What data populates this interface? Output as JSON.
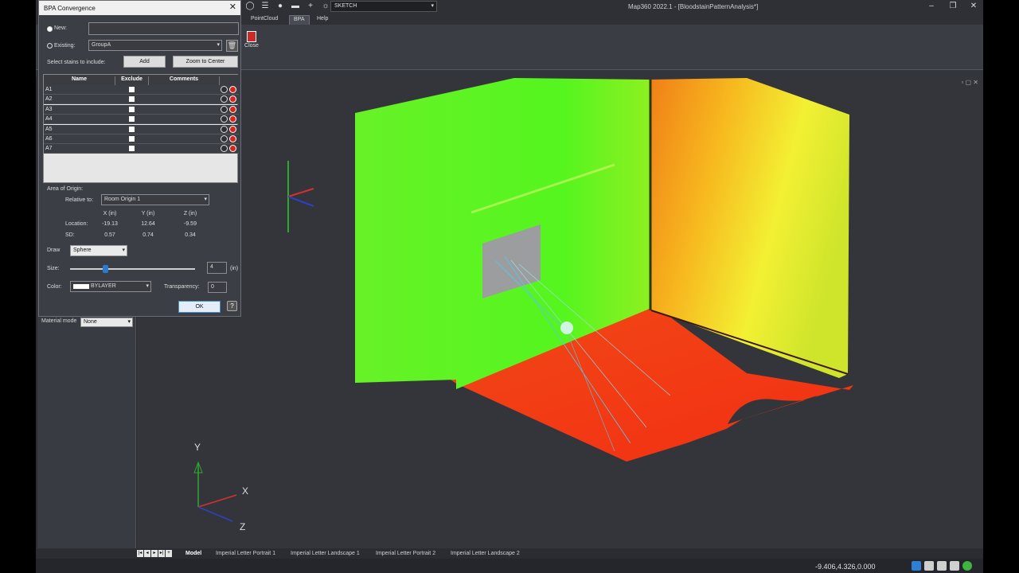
{
  "window": {
    "title": "Map360 2022.1 - [BloodstainPatternAnalysis*]",
    "workspace": "SKETCH"
  },
  "ribbon": {
    "tabs": [
      "PointCloud",
      "BPA",
      "Help"
    ],
    "active_tab": "BPA",
    "close_label": "Close"
  },
  "dialog": {
    "title": "BPA Convergence",
    "new_label": "New:",
    "new_value": "",
    "existing_label": "Existing:",
    "existing_value": "GroupA",
    "select_label": "Select stains to include:",
    "add_label": "Add",
    "zoom_label": "Zoom to Center",
    "table": {
      "headers": [
        "Name",
        "Exclude",
        "Comments"
      ],
      "rows": [
        {
          "name": "A1"
        },
        {
          "name": "A2"
        },
        {
          "name": "A3"
        },
        {
          "name": "A4"
        },
        {
          "name": "A5"
        },
        {
          "name": "A6"
        },
        {
          "name": "A7"
        }
      ]
    },
    "area_of_origin": "Area of Origin:",
    "relative_label": "Relative to:",
    "relative_value": "Room Origin 1",
    "columns": [
      "X (in)",
      "Y (in)",
      "Z (in)"
    ],
    "location_label": "Location:",
    "location": [
      "-19.13",
      "12.64",
      "-9.59"
    ],
    "sd_label": "SD:",
    "sd": [
      "0.57",
      "0.74",
      "0.34"
    ],
    "draw_label": "Draw",
    "draw_value": "Sphere",
    "size_label": "Size:",
    "size_value": "4",
    "size_unit": "(in)",
    "size_fraction": 0.28,
    "color_label": "Color:",
    "color_value": "BYLAYER",
    "transparency_label": "Transparency:",
    "transparency_value": "0",
    "ok_label": "OK",
    "help_label": "?"
  },
  "palette": {
    "material_label": "Material mode",
    "material_value": "None"
  },
  "axes": {
    "y": "Y",
    "x": "X",
    "z": "Z"
  },
  "layout_tabs": [
    "Model",
    "Imperial Letter Portrait 1",
    "Imperial Letter Landscape 1",
    "Imperial Letter Portrait 2",
    "Imperial Letter Landscape 2"
  ],
  "status": {
    "coords": "-9.406,4.326,0.000"
  }
}
